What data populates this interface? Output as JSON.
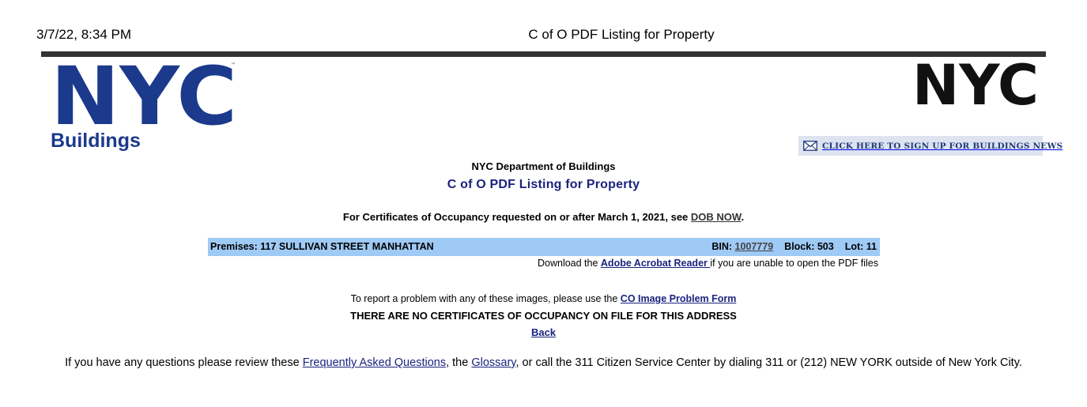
{
  "print_header": {
    "date": "3/7/22, 8:34 PM",
    "title": "C of O PDF Listing for Property"
  },
  "logo_left": {
    "letters": "NYC",
    "caption": "Buildings",
    "color": "#1b3a8c"
  },
  "logo_right": {
    "letters": "NYC",
    "color": "#111111"
  },
  "news_banner": {
    "label": "CLICK HERE TO SIGN UP FOR BUILDINGS NEWS",
    "icon": "envelope-icon"
  },
  "header": {
    "department": "NYC Department of Buildings",
    "heading": "C of O PDF Listing for Property"
  },
  "notice": {
    "text_before": "For Certificates of Occupancy requested on or after March 1, 2021, see ",
    "link": "DOB NOW",
    "text_after": "."
  },
  "premises": {
    "label": "Premises: 117 SULLIVAN STREET MANHATTAN",
    "bin_label": "BIN: ",
    "bin": "1007779",
    "block": "Block: 503",
    "lot": "Lot: 11",
    "bar_color": "#9fcaf5"
  },
  "download": {
    "before": "Download the ",
    "link": "Adobe Acrobat Reader ",
    "after": "if you are unable to open the PDF files"
  },
  "report": {
    "before": "To report a problem with any of these images, please use the ",
    "link": "CO Image Problem Form"
  },
  "no_certificates": "THERE ARE NO CERTIFICATES OF OCCUPANCY ON FILE FOR THIS ADDRESS",
  "back_link": "Back",
  "faq": {
    "before": "If you have any questions please review these ",
    "faq_link": "Frequently Asked Questions",
    "middle": ", the ",
    "glossary_link": "Glossary",
    "after": ", or call the 311 Citizen Service Center by dialing 311 or (212) NEW YORK outside of New York City."
  }
}
